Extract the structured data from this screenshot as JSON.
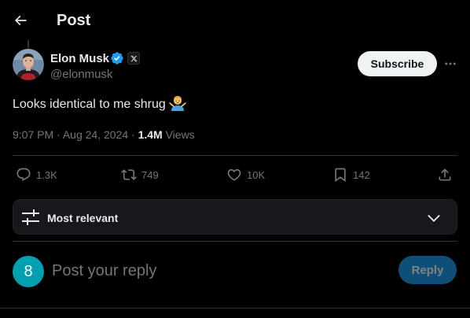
{
  "header": {
    "title": "Post",
    "back_icon": "arrow-left-icon"
  },
  "author": {
    "display_name": "Elon Musk",
    "handle": "@elonmusk",
    "verified_icon": "verified-badge-icon",
    "affiliate_badge_icon": "x-logo-icon",
    "avatar": "avatar-photo"
  },
  "actions_top": {
    "subscribe_label": "Subscribe",
    "more_icon": "more-horizontal-icon"
  },
  "post": {
    "text": "Looks identical to me shrug",
    "emoji": "🤷‍♂️",
    "time": "9:07 PM",
    "date": "Aug 24, 2024",
    "sep": "·",
    "views_count": "1.4M",
    "views_label": "Views"
  },
  "engagement": {
    "replies": "1.3K",
    "reposts": "749",
    "likes": "10K",
    "bookmarks": "142",
    "share_icon": "share-icon"
  },
  "sort": {
    "label": "Most relevant",
    "icon": "sliders-icon",
    "chevron": "chevron-down-icon"
  },
  "composer": {
    "avatar_letter": "8",
    "placeholder": "Post your reply",
    "value": "",
    "button_label": "Reply"
  },
  "colors": {
    "background": "#000000",
    "text_primary": "#e7e9ea",
    "text_secondary": "#71767b",
    "accent": "#1d9bf0",
    "divider": "#2f3336",
    "reply_avatar": "#00a0b0"
  }
}
